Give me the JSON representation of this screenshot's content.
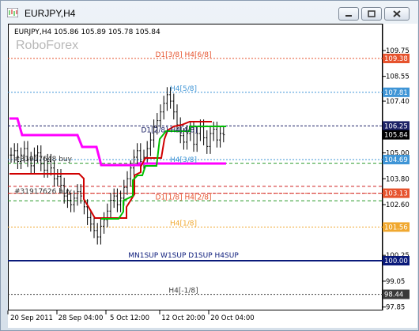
{
  "window": {
    "title": "EURJPY,H4"
  },
  "chart": {
    "info": "EURJPY,H4  105.86 105.89 105.78 105.84",
    "brand": "RoboForex",
    "price_labels": [
      {
        "text": "109.75",
        "price": 109.75
      },
      {
        "text": "108.55",
        "price": 108.55
      },
      {
        "text": "107.40",
        "price": 107.4
      },
      {
        "text": "105.00",
        "price": 105.0
      },
      {
        "text": "103.80",
        "price": 103.8
      },
      {
        "text": "102.60",
        "price": 102.6
      },
      {
        "text": "100.25",
        "price": 100.25
      },
      {
        "text": "99.05",
        "price": 99.05
      },
      {
        "text": "97.85",
        "price": 97.85
      }
    ],
    "price_tags": [
      {
        "text": "109.38",
        "price": 109.38,
        "color": "#e6532e"
      },
      {
        "text": "107.81",
        "price": 107.81,
        "color": "#3f95d6"
      },
      {
        "text": "106.25",
        "price": 106.25,
        "color": "#1c2266"
      },
      {
        "text": "105.84",
        "price": 105.84,
        "color": "#000000"
      },
      {
        "text": "104.69",
        "price": 104.69,
        "color": "#3f95d6"
      },
      {
        "text": "103.13",
        "price": 103.13,
        "color": "#e6532e"
      },
      {
        "text": "101.56",
        "price": 101.56,
        "color": "#f0a830"
      },
      {
        "text": "100.00",
        "price": 100.0,
        "color": "#0a1a7a"
      },
      {
        "text": "98.44",
        "price": 98.44,
        "color": "#3a3a3a"
      }
    ],
    "levels": [
      {
        "label": "D1[3/8] H4[6/8]",
        "price": 109.38,
        "color": "#e6532e"
      },
      {
        "label": "H4[5/8]",
        "price": 107.81,
        "color": "#3f95d6"
      },
      {
        "label": "D1[2/8] H4[4/8]",
        "price": 106.25,
        "color": "#1c2266"
      },
      {
        "label": "H4[3/8]",
        "price": 104.69,
        "color": "#3f95d6"
      },
      {
        "label": "D1[1/8] H4[2/8]",
        "price": 103.13,
        "color": "#e6532e"
      },
      {
        "label": "H4[1/8]",
        "price": 101.56,
        "color": "#f0a830"
      },
      {
        "label": "MN1SUP W1SUP D1SUP H4SUP",
        "price": 100.0,
        "color": "#0a1a7a"
      },
      {
        "label": "H4[-1/8]",
        "price": 98.44,
        "color": "#3a3a3a"
      }
    ],
    "order_labels": [
      "#31917648 buy",
      "#31917626 buy"
    ],
    "time_labels": [
      "20 Sep 2011",
      "28 Sep 04:00",
      "5 Oct 12:00",
      "12 Oct 20:00",
      "20 Oct 04:00"
    ]
  }
}
